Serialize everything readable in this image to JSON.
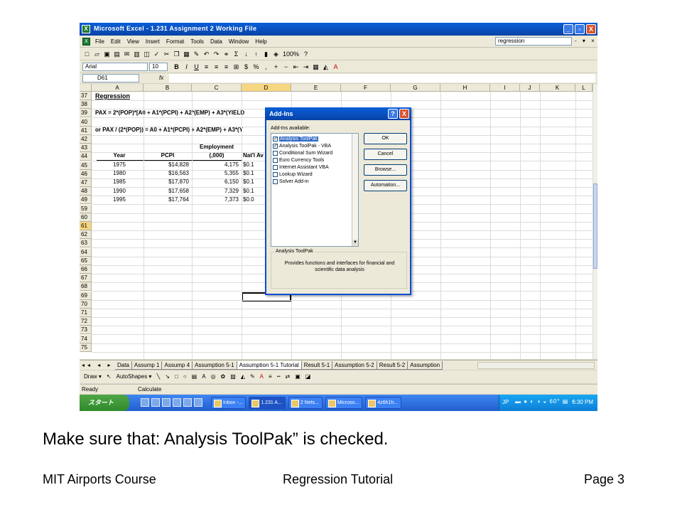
{
  "window": {
    "title": "Microsoft Excel - 1.231 Assignment 2 Working File",
    "min": "_",
    "max": "▫",
    "close": "X"
  },
  "menu": {
    "items": [
      "File",
      "Edit",
      "View",
      "Insert",
      "Format",
      "Tools",
      "Data",
      "Window",
      "Help"
    ],
    "help_box": "regression",
    "right_controls": "- ▾ ×"
  },
  "toolbar": {
    "zoom": "100%",
    "font_name": "Arial",
    "font_size": "10"
  },
  "formula_bar": {
    "name_box": "D61",
    "fx": "fx"
  },
  "grid": {
    "columns": [
      "A",
      "B",
      "C",
      "D",
      "E",
      "F",
      "G",
      "H",
      "I",
      "J",
      "K",
      "L"
    ],
    "selected_column": "D",
    "rows": [
      "37",
      "38",
      "39",
      "40",
      "41",
      "42",
      "43",
      "44",
      "45",
      "46",
      "47",
      "48",
      "49",
      "59",
      "60",
      "61",
      "62",
      "63",
      "64",
      "65",
      "66",
      "67",
      "68",
      "69",
      "70",
      "71",
      "72",
      "73",
      "74",
      "75"
    ],
    "selected_row": "61",
    "heading": "Regression",
    "formula_line1": "PAX = 2*(POP)*[A0 + A1*(PCPI) + A2*(EMP) + A3*(YIELD",
    "formula_line2": "or PAX / (2*(POP)) = A0 + A1*(PCPI) + A2*(EMP) + A3*(Y",
    "table_headers": {
      "year": "Year",
      "pcpi": "PCPI",
      "employment_line1": "Employment",
      "employment_line2": "(,000)",
      "natl": "Nat'l Av"
    },
    "table_rows": [
      {
        "year": "1975",
        "pcpi": "$14,828",
        "emp": "4,175",
        "natl": "$0.1"
      },
      {
        "year": "1980",
        "pcpi": "$16,563",
        "emp": "5,355",
        "natl": "$0.1"
      },
      {
        "year": "1985",
        "pcpi": "$17,870",
        "emp": "6,150",
        "natl": "$0.1"
      },
      {
        "year": "1990",
        "pcpi": "$17,658",
        "emp": "7,329",
        "natl": "$0.1"
      },
      {
        "year": "1995",
        "pcpi": "$17,764",
        "emp": "7,373",
        "natl": "$0.0"
      }
    ]
  },
  "sheet_tabs": {
    "nav": "◂◂ ◂ ▸ ▸▸",
    "tabs": [
      "Data",
      "Assump 1",
      "Assump 4",
      "Assumption 5-1",
      "Assumption 5-1 Tutorial",
      "Result 5-1",
      "Assumption 5-2",
      "Result 5-2",
      "Assumption"
    ],
    "active_tab": "Assumption 5-1 Tutorial"
  },
  "draw_toolbar": {
    "draw": "Draw ▾",
    "autoshapes": "AutoShapes ▾"
  },
  "status": {
    "ready": "Ready",
    "calculate": "Calculate"
  },
  "taskbar": {
    "start": "スタート",
    "tasks": [
      "Inbox -...",
      "1.231 A...",
      "2 Nets...",
      "Microso...",
      "4z6h1h..."
    ],
    "active_task": "1.231 A...",
    "lang": "JP",
    "tray_temp": "60°",
    "clock": "6:30 PM"
  },
  "dialog": {
    "title": "Add-Ins",
    "help": "?",
    "close": "X",
    "available_label": "Add-Ins available:",
    "addins": [
      {
        "label": "Analysis ToolPak",
        "checked": true,
        "selected": true
      },
      {
        "label": "Analysis ToolPak - VBA",
        "checked": true,
        "selected": false
      },
      {
        "label": "Conditional Sum Wizard",
        "checked": false,
        "selected": false
      },
      {
        "label": "Euro Currency Tools",
        "checked": false,
        "selected": false
      },
      {
        "label": "Internet Assistant VBA",
        "checked": false,
        "selected": false
      },
      {
        "label": "Lookup Wizard",
        "checked": false,
        "selected": false
      },
      {
        "label": "Solver Add-in",
        "checked": false,
        "selected": false
      }
    ],
    "buttons": {
      "ok": "OK",
      "cancel": "Cancel",
      "browse": "Browse...",
      "automation": "Automation..."
    },
    "group_title": "Analysis ToolPak",
    "description": "Provides functions and interfaces for financial and scientific data analysis"
  },
  "slide": {
    "caption": "Make sure that:  Analysis ToolPak” is checked.",
    "footer_left": "MIT Airports Course",
    "footer_center": "Regression Tutorial",
    "footer_right": "Page 3"
  }
}
